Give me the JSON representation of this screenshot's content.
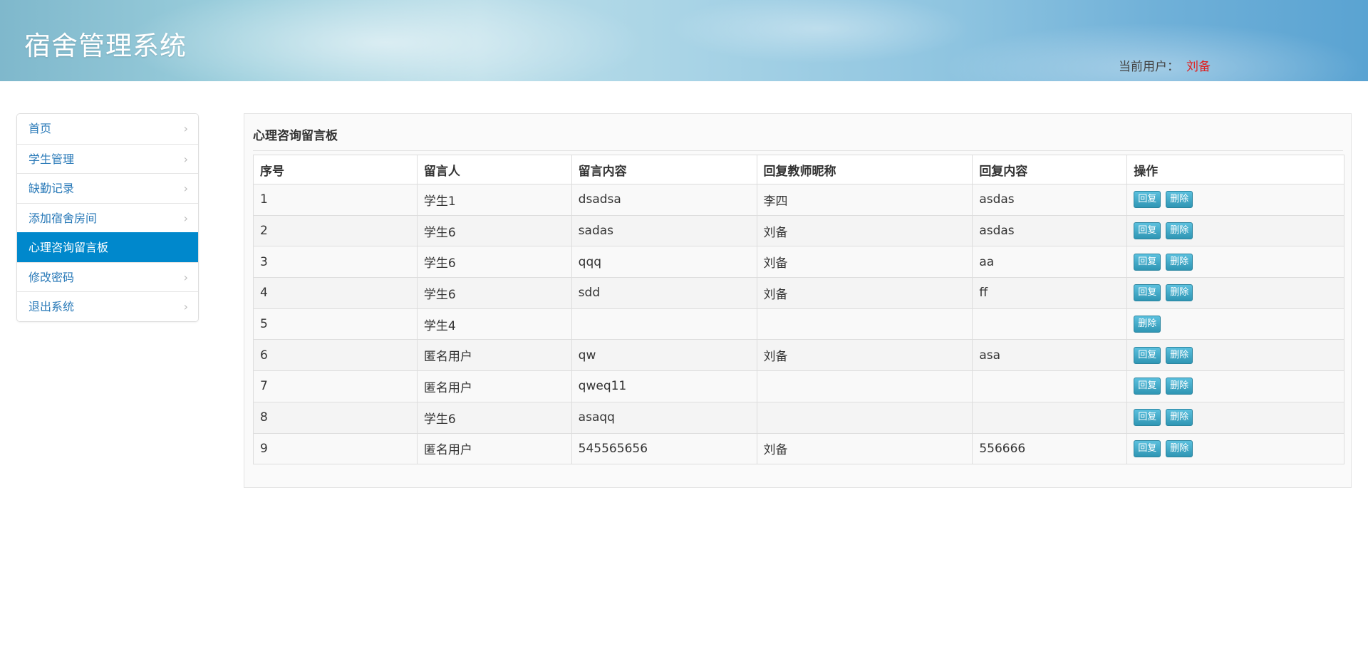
{
  "app": {
    "title": "宿舍管理系统"
  },
  "header": {
    "current_user_label": "当前用户：",
    "current_user_name": "刘备"
  },
  "sidebar": {
    "items": [
      {
        "label": "首页",
        "active": false
      },
      {
        "label": "学生管理",
        "active": false
      },
      {
        "label": "缺勤记录",
        "active": false
      },
      {
        "label": "添加宿舍房间",
        "active": false
      },
      {
        "label": "心理咨询留言板",
        "active": true
      },
      {
        "label": "修改密码",
        "active": false
      },
      {
        "label": "退出系统",
        "active": false
      }
    ]
  },
  "panel": {
    "title": "心理咨询留言板"
  },
  "table": {
    "headers": [
      "序号",
      "留言人",
      "留言内容",
      "回复教师昵称",
      "回复内容",
      "操作"
    ],
    "reply_label": "回复",
    "delete_label": "删除",
    "rows": [
      {
        "id": "1",
        "author": "学生1",
        "content": "dsadsa",
        "teacher": "李四",
        "reply": "asdas",
        "can_reply": true
      },
      {
        "id": "2",
        "author": "学生6",
        "content": "sadas",
        "teacher": "刘备",
        "reply": "asdas",
        "can_reply": true
      },
      {
        "id": "3",
        "author": "学生6",
        "content": "qqq",
        "teacher": "刘备",
        "reply": "aa",
        "can_reply": true
      },
      {
        "id": "4",
        "author": "学生6",
        "content": "sdd",
        "teacher": "刘备",
        "reply": "ff",
        "can_reply": true
      },
      {
        "id": "5",
        "author": "学生4",
        "content": "",
        "teacher": "",
        "reply": "",
        "can_reply": false
      },
      {
        "id": "6",
        "author": "匿名用户",
        "content": "qw",
        "teacher": "刘备",
        "reply": "asa",
        "can_reply": true
      },
      {
        "id": "7",
        "author": "匿名用户",
        "content": "qweq11",
        "teacher": "",
        "reply": "",
        "can_reply": true
      },
      {
        "id": "8",
        "author": "学生6",
        "content": "asaqq",
        "teacher": "",
        "reply": "",
        "can_reply": true
      },
      {
        "id": "9",
        "author": "匿名用户",
        "content": "545565656",
        "teacher": "刘备",
        "reply": "556666",
        "can_reply": true
      }
    ]
  },
  "colors": {
    "accent": "#0088cc",
    "username": "#e0201f",
    "button": "#2f96b4"
  },
  "icons": {
    "nav_chevron": "chevron-right-icon"
  }
}
